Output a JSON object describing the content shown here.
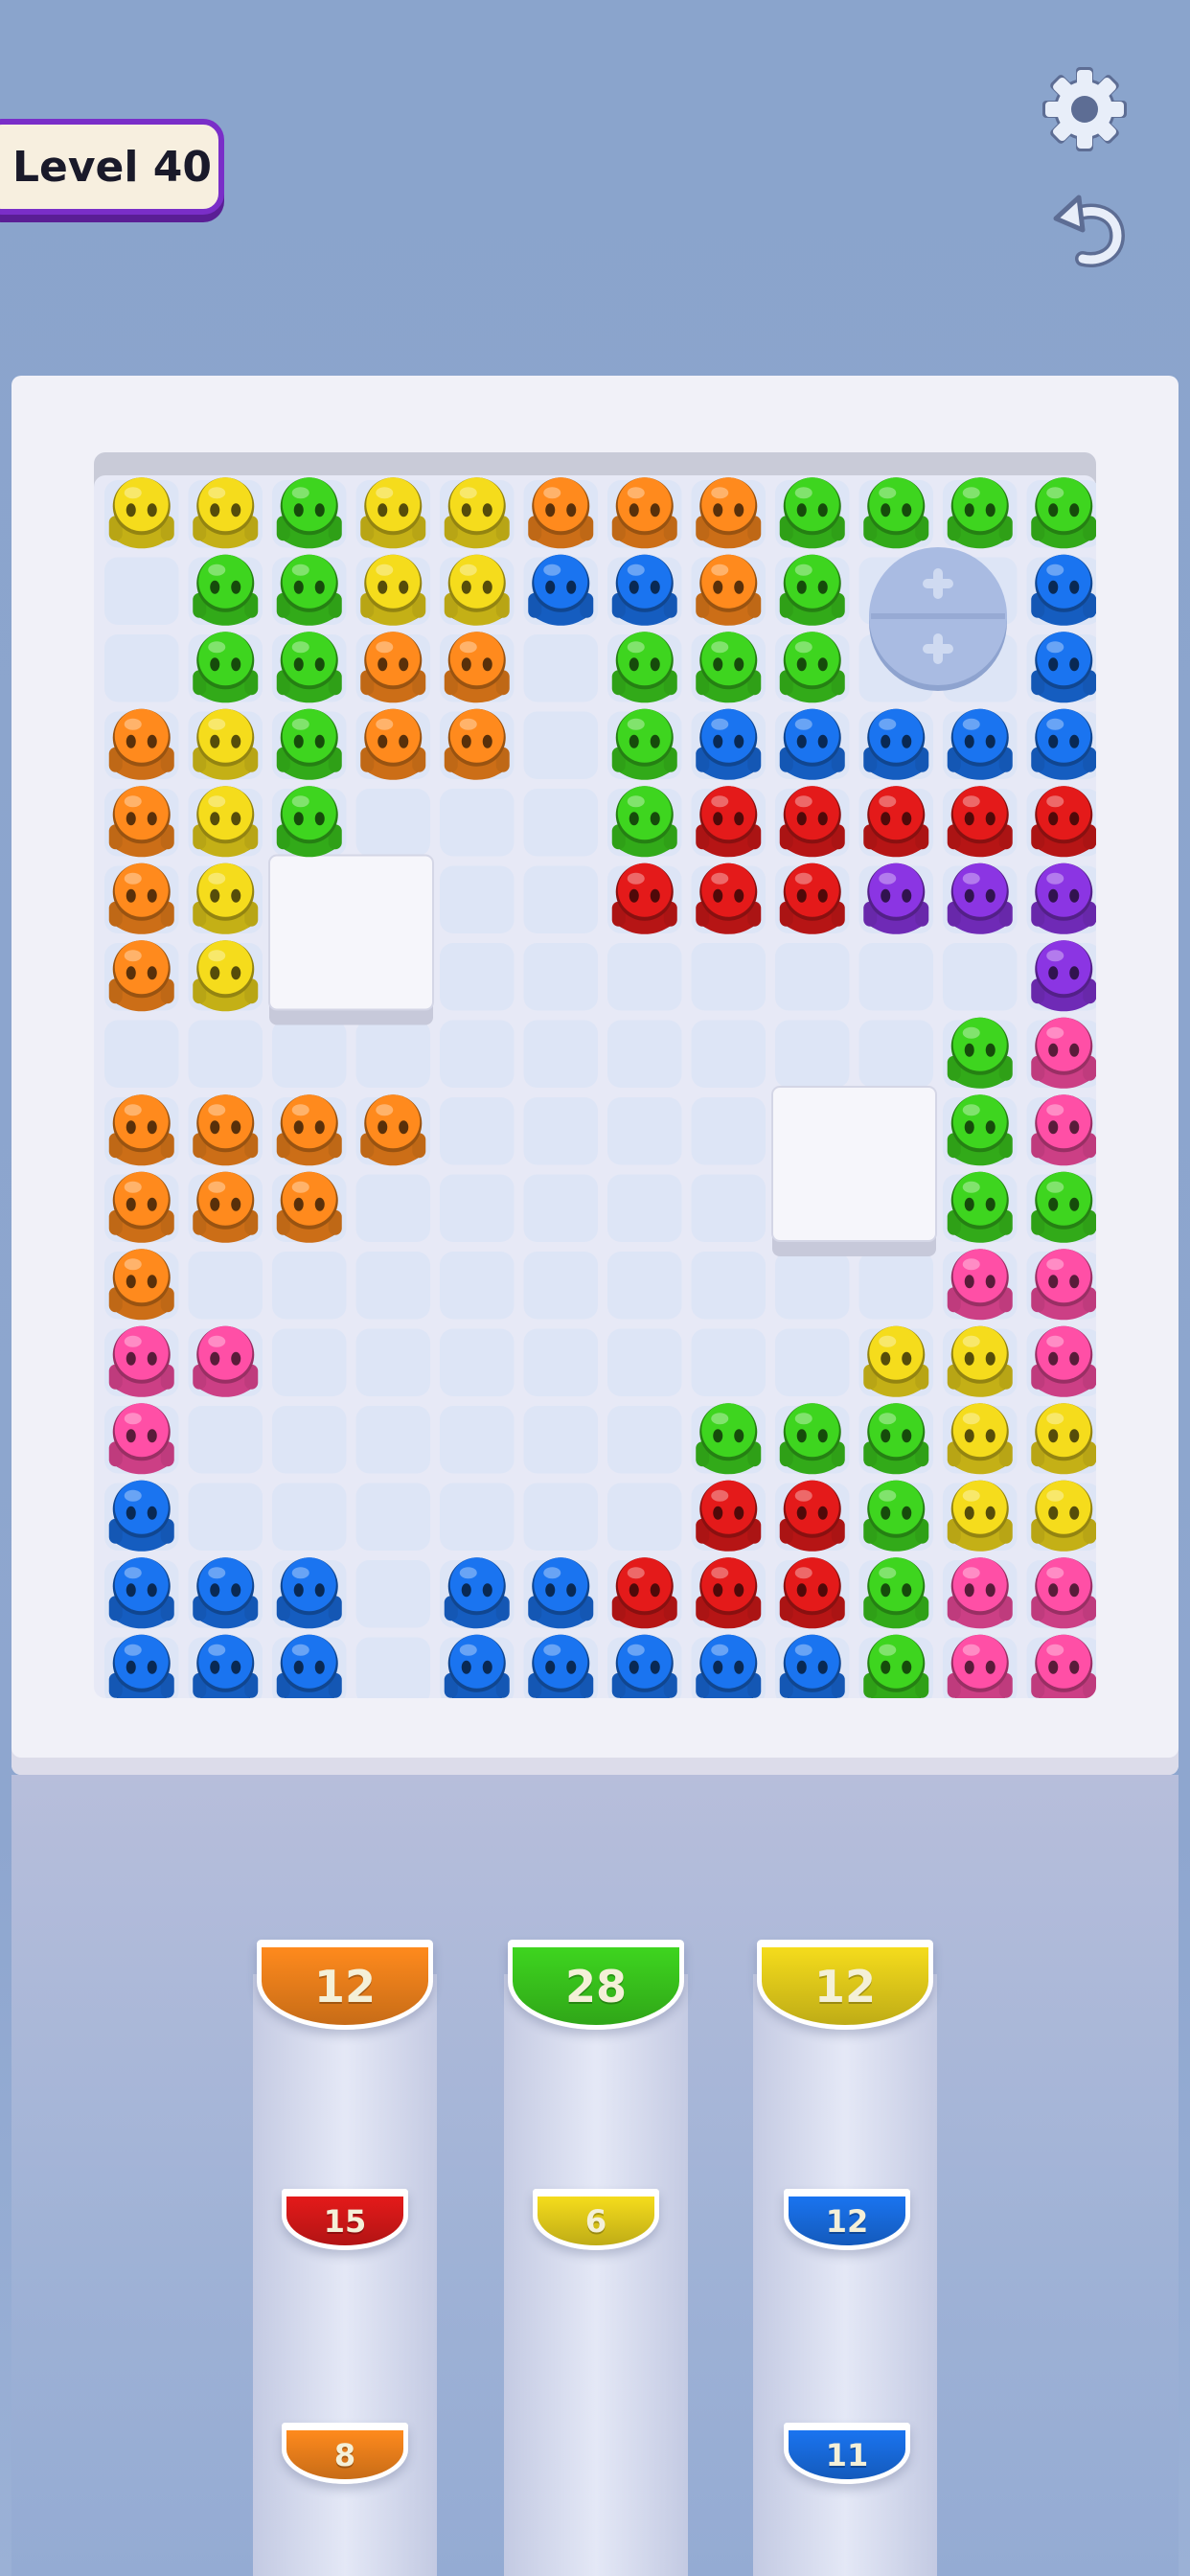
{
  "hud": {
    "level_label": "Level 40",
    "settings_icon": "gear-icon",
    "undo_icon": "undo-icon"
  },
  "colors": {
    "Y": "#f5dc1c",
    "O": "#ff8a1d",
    "G": "#3ed51f",
    "B": "#1a74f0",
    "R": "#e41a1a",
    "P": "#8b35e3",
    "K": "#ff4fa6"
  },
  "board": {
    "rows": [
      "YYGYYOOOGGGG",
      ".GGYYBBOG..B",
      ".GGOO.GGG..B",
      "OYGOO.GBBBBB",
      "OYG...GRRRRR",
      "OY....RRRPPP",
      "OY.........P",
      "..........GK",
      "OOOO......GK",
      "OOO.......GG",
      "O.........KK",
      "KK.......YYK",
      "K......GGGYY",
      "B......RRGYY",
      "BBB.BBRRRGKK",
      "BBB.BBBBBGKK"
    ],
    "blockers": [
      {
        "row": 5,
        "col": 2,
        "rows": 2,
        "cols": 2
      },
      {
        "row": 8,
        "col": 8,
        "rows": 2,
        "cols": 2
      }
    ],
    "expand_slot": {
      "row": 1,
      "col": 9,
      "icon": "plus-icon"
    }
  },
  "queues": [
    {
      "color": "O",
      "count": "12"
    },
    {
      "color": "G",
      "count": "28"
    },
    {
      "color": "Y",
      "count": "12"
    },
    {
      "color": "R",
      "count": "15"
    },
    {
      "color": "Y",
      "count": "6"
    },
    {
      "color": "B",
      "count": "12"
    },
    {
      "color": "O",
      "count": "8"
    },
    {
      "color": "B",
      "count": "11"
    }
  ]
}
